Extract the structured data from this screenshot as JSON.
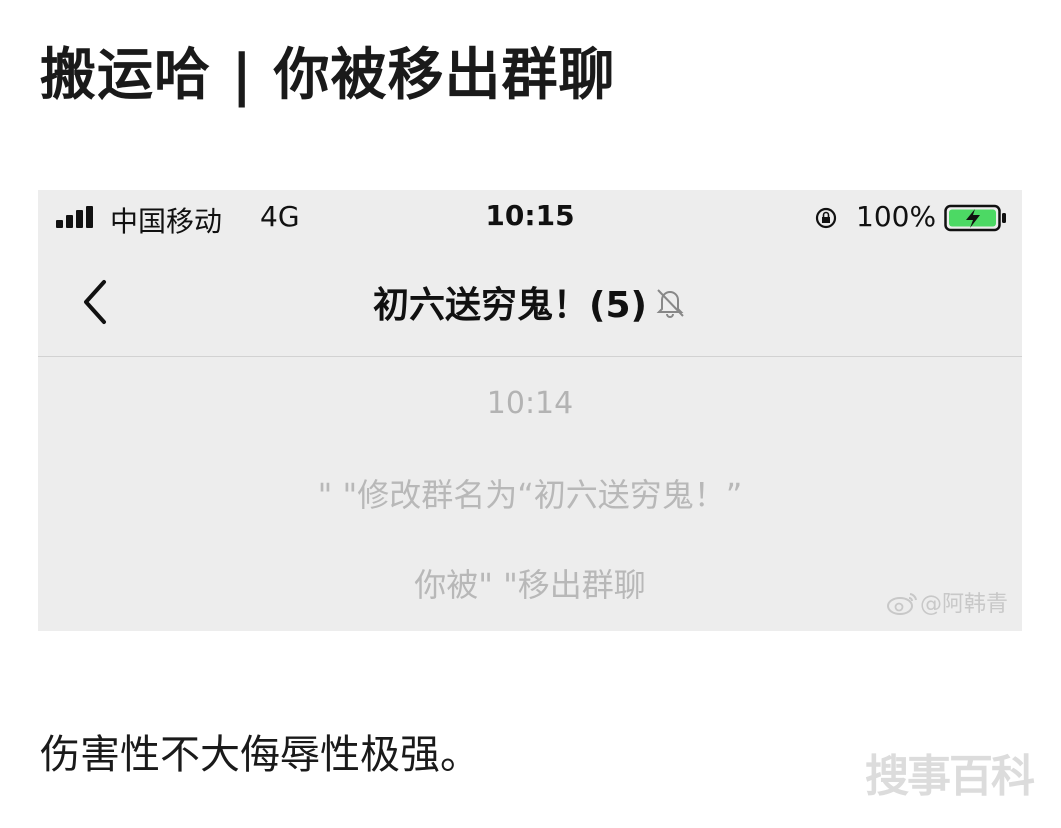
{
  "post": {
    "title": "搬运哈 | 你被移出群聊",
    "caption": "伤害性不大侮辱性极强。",
    "site_watermark": "搜事百科"
  },
  "status_bar": {
    "carrier": "中国移动",
    "network": "4G",
    "time": "10:15",
    "battery_percent": "100%",
    "battery_state": "charging",
    "battery_color": "#4cd964"
  },
  "chat": {
    "title": "初六送穷鬼！(5)",
    "back_icon": "chevron-left-icon",
    "mute_icon": "bell-off-icon"
  },
  "messages": {
    "timestamp": "10:14",
    "system_1": "\" \"修改群名为“初六送穷鬼！”",
    "system_2": "你被\" \"移出群聊"
  },
  "watermark": {
    "weibo": "@阿韩青"
  }
}
